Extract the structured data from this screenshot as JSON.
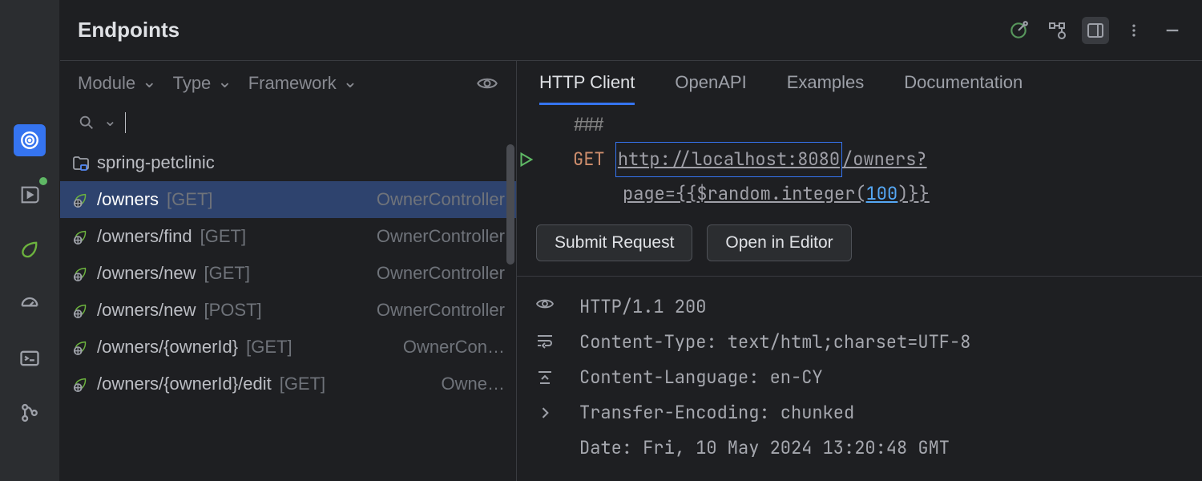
{
  "title": "Endpoints",
  "filters": {
    "module": "Module",
    "type": "Type",
    "framework": "Framework"
  },
  "search": {
    "placeholder": ""
  },
  "project": "spring-petclinic",
  "endpoints": [
    {
      "path": "/owners",
      "method": "[GET]",
      "controller": "OwnerController",
      "selected": true
    },
    {
      "path": "/owners/find",
      "method": "[GET]",
      "controller": "OwnerController",
      "selected": false
    },
    {
      "path": "/owners/new",
      "method": "[GET]",
      "controller": "OwnerController",
      "selected": false
    },
    {
      "path": "/owners/new",
      "method": "[POST]",
      "controller": "OwnerController",
      "selected": false
    },
    {
      "path": "/owners/{ownerId}",
      "method": "[GET]",
      "controller": "OwnerCon…",
      "selected": false
    },
    {
      "path": "/owners/{ownerId}/edit",
      "method": "[GET]",
      "controller": "Owne…",
      "selected": false
    }
  ],
  "tabs": [
    "HTTP Client",
    "OpenAPI",
    "Examples",
    "Documentation"
  ],
  "active_tab": 0,
  "request": {
    "marker": "###",
    "verb": "GET",
    "url_host": "http://localhost:8080",
    "url_path": "/owners?",
    "line2_prefix": "page={{$random.integer(",
    "line2_num": "100",
    "line2_suffix": ")}}"
  },
  "actions": {
    "submit": "Submit Request",
    "open": "Open in Editor"
  },
  "response_lines": [
    "HTTP/1.1 200",
    "Content-Type: text/html;charset=UTF-8",
    "Content-Language: en-CY",
    "Transfer-Encoding: chunked",
    "Date: Fri, 10 May 2024 13:20:48 GMT"
  ]
}
